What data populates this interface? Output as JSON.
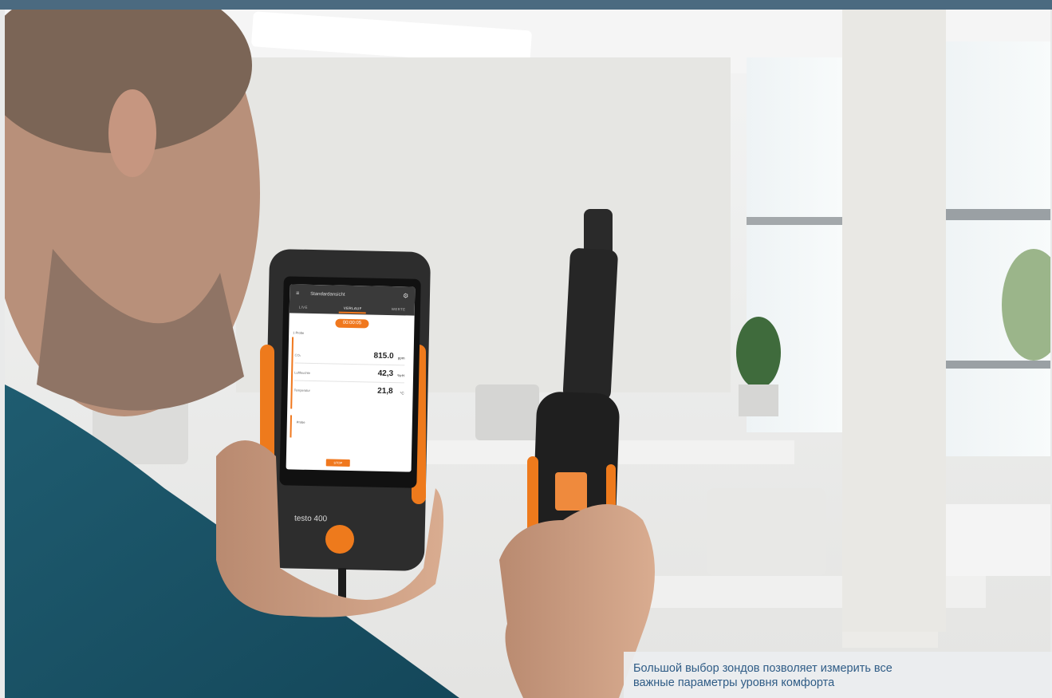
{
  "photo": {
    "description_label": "testo 400 handheld measuring instrument with probe in office"
  },
  "device": {
    "brand_label": "testo 400",
    "screen": {
      "title": "Standardansicht",
      "tabs": [
        "LIVE",
        "VERLAUF",
        "WERTE"
      ],
      "timer": "00:00:05",
      "probe1_label": "1 Probe",
      "readings": [
        {
          "label": "CO₂",
          "value": "815.0",
          "unit": "ppm"
        },
        {
          "label": "Luftfeuchte",
          "value": "42,3",
          "unit": "%rH"
        },
        {
          "label": "Temperatur",
          "value": "21,8",
          "unit": "°C"
        }
      ],
      "probe2_label": "Probe",
      "stop_label": "STOP"
    }
  },
  "caption": {
    "line1": "Большой выбор зондов позволяет измерить все",
    "line2": "важные параметры уровня комфорта"
  },
  "colors": {
    "top_bar": "#4b6a80",
    "accent_orange": "#f0781e",
    "caption_text": "#2f5c86"
  }
}
